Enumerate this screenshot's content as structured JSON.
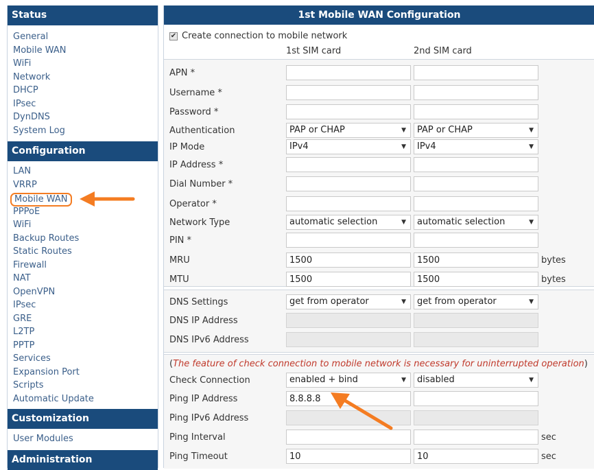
{
  "sidebar": {
    "status": {
      "title": "Status",
      "items": [
        "General",
        "Mobile WAN",
        "WiFi",
        "Network",
        "DHCP",
        "IPsec",
        "DynDNS",
        "System Log"
      ]
    },
    "configuration": {
      "title": "Configuration",
      "items": [
        "LAN",
        "VRRP",
        "Mobile WAN",
        "PPPoE",
        "WiFi",
        "Backup Routes",
        "Static Routes",
        "Firewall",
        "NAT",
        "OpenVPN",
        "IPsec",
        "GRE",
        "L2TP",
        "PPTP",
        "Services",
        "Expansion Port",
        "Scripts",
        "Automatic Update"
      ],
      "active_index": 2
    },
    "customization": {
      "title": "Customization",
      "items": [
        "User Modules"
      ]
    },
    "administration": {
      "title": "Administration"
    }
  },
  "main": {
    "title": "1st Mobile WAN Configuration",
    "create_connection_label": "Create connection to mobile network",
    "create_connection_checked": true,
    "sim1_header": "1st SIM card",
    "sim2_header": "2nd SIM card",
    "fields": {
      "apn": {
        "label": "APN *",
        "sim1": "",
        "sim2": ""
      },
      "username": {
        "label": "Username *",
        "sim1": "",
        "sim2": ""
      },
      "password": {
        "label": "Password *",
        "sim1": "",
        "sim2": ""
      },
      "authentication": {
        "label": "Authentication",
        "sim1": "PAP or CHAP",
        "sim2": "PAP or CHAP"
      },
      "ip_mode": {
        "label": "IP Mode",
        "sim1": "IPv4",
        "sim2": "IPv4"
      },
      "ip_address": {
        "label": "IP Address *",
        "sim1": "",
        "sim2": ""
      },
      "dial_number": {
        "label": "Dial Number *",
        "sim1": "",
        "sim2": ""
      },
      "operator": {
        "label": "Operator *",
        "sim1": "",
        "sim2": ""
      },
      "network_type": {
        "label": "Network Type",
        "sim1": "automatic selection",
        "sim2": "automatic selection"
      },
      "pin": {
        "label": "PIN *",
        "sim1": "",
        "sim2": ""
      },
      "mru": {
        "label": "MRU",
        "sim1": "1500",
        "sim2": "1500",
        "unit": "bytes"
      },
      "mtu": {
        "label": "MTU",
        "sim1": "1500",
        "sim2": "1500",
        "unit": "bytes"
      },
      "dns_settings": {
        "label": "DNS Settings",
        "sim1": "get from operator",
        "sim2": "get from operator"
      },
      "dns_ip": {
        "label": "DNS IP Address",
        "sim1": "",
        "sim2": ""
      },
      "dns_ipv6": {
        "label": "DNS IPv6 Address",
        "sim1": "",
        "sim2": ""
      },
      "check_connection": {
        "label": "Check Connection",
        "sim1": "enabled + bind",
        "sim2": "disabled"
      },
      "ping_ip": {
        "label": "Ping IP Address",
        "sim1": "8.8.8.8",
        "sim2": ""
      },
      "ping_ipv6": {
        "label": "Ping IPv6 Address",
        "sim1": "",
        "sim2": ""
      },
      "ping_interval": {
        "label": "Ping Interval",
        "sim1": "",
        "sim2": "",
        "unit": "sec"
      },
      "ping_timeout": {
        "label": "Ping Timeout",
        "sim1": "10",
        "sim2": "10",
        "unit": "sec"
      }
    },
    "check_notice_open": "(",
    "check_notice": "The feature of check connection to mobile network is necessary for uninterrupted operation",
    "check_notice_close": ")"
  },
  "colors": {
    "header_bg": "#1a4b7c",
    "link": "#3b5f8a",
    "annotation_arrow": "#f47c22",
    "notice": "#c0392b"
  },
  "icons": {
    "dropdown": "caret-down-icon",
    "annotation": "arrow-icon"
  }
}
